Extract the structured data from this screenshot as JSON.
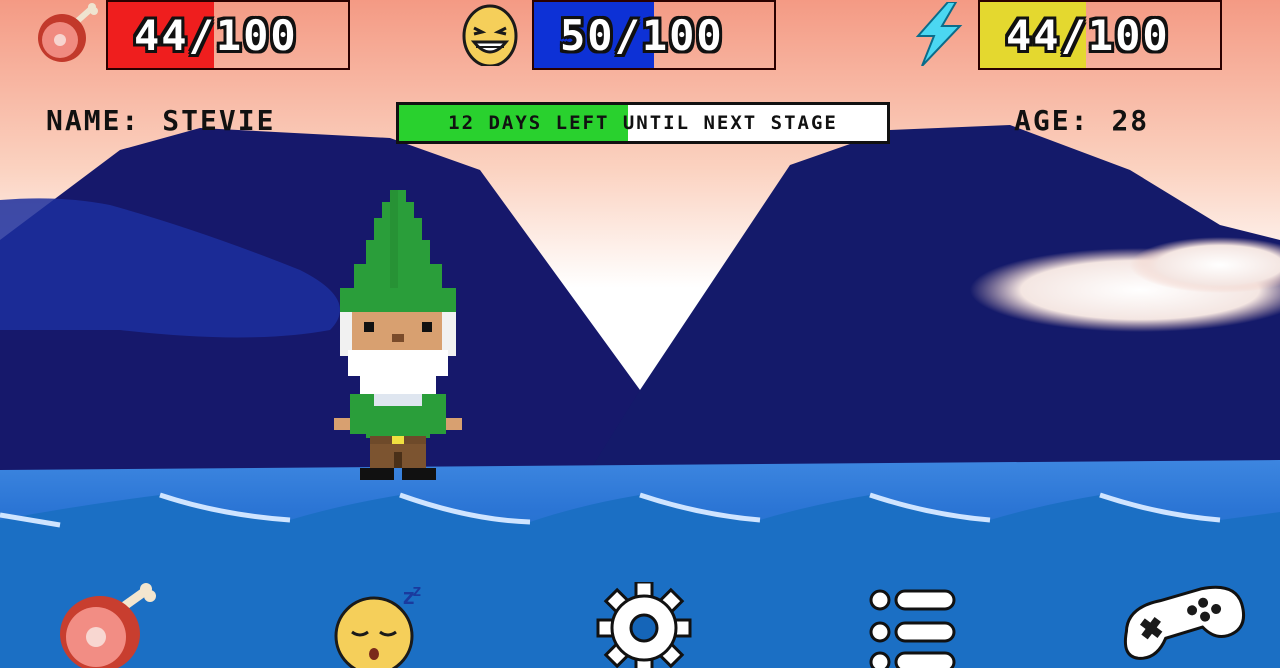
{
  "hud": {
    "hunger": {
      "value": 44,
      "max": 100,
      "text": "44/100",
      "color": "#ef1e1e",
      "icon": "meat-icon"
    },
    "happiness": {
      "value": 50,
      "max": 100,
      "text": "50/100",
      "color": "#0d31d6",
      "icon": "grinning-face-icon"
    },
    "energy": {
      "value": 44,
      "max": 100,
      "text": "44/100",
      "color": "#e4d82f",
      "icon": "lightning-bolt-icon"
    }
  },
  "pet": {
    "name_label": "NAME:",
    "name": "STEVIE",
    "age_label": "AGE:",
    "age": "28"
  },
  "stage": {
    "text": "12 DAYS LEFT UNTIL NEXT STAGE",
    "progress": 0.47,
    "color": "#29d12e"
  },
  "bottom_bar": [
    {
      "icon": "meat-icon",
      "action": "feed"
    },
    {
      "icon": "sleeping-face-icon",
      "action": "sleep"
    },
    {
      "icon": "gear-icon",
      "action": "settings"
    },
    {
      "icon": "list-icon",
      "action": "menu"
    },
    {
      "icon": "gamepad-icon",
      "action": "play"
    }
  ]
}
